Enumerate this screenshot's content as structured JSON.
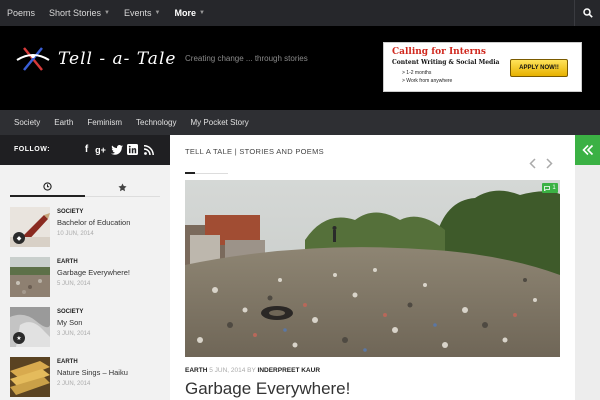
{
  "topnav": {
    "items": [
      {
        "label": "Poems"
      },
      {
        "label": "Short Stories"
      },
      {
        "label": "Events"
      },
      {
        "label": "More"
      }
    ]
  },
  "header": {
    "site_title": "Tell - a- Tale",
    "tagline": "Creating change ... through stories",
    "ad": {
      "title": "Calling for Interns",
      "subtitle": "Content Writing & Social Media",
      "bullet1": "> 1-2 months",
      "bullet2": "> Work from anywhere",
      "button": "APPLY NOW!!"
    }
  },
  "catnav": {
    "items": [
      {
        "label": "Society"
      },
      {
        "label": "Earth"
      },
      {
        "label": "Feminism"
      },
      {
        "label": "Technology"
      },
      {
        "label": "My Pocket Story"
      }
    ]
  },
  "sidebar": {
    "follow_label": "FOLLOW:",
    "posts": [
      {
        "category": "SOCIETY",
        "title": "Bachelor of Education",
        "date": "10 JUN, 2014",
        "icon": "camera-icon"
      },
      {
        "category": "EARTH",
        "title": "Garbage Everywhere!",
        "date": "5 JUN, 2014",
        "icon": ""
      },
      {
        "category": "SOCIETY",
        "title": "My Son",
        "date": "3 JUN, 2014",
        "icon": "star-icon"
      },
      {
        "category": "EARTH",
        "title": "Nature Sings – Haiku",
        "date": "2 JUN, 2014",
        "icon": ""
      }
    ]
  },
  "main": {
    "breadcrumb": "TELL A TALE | STORIES AND POEMS",
    "comment_count": "1",
    "meta": {
      "category": "EARTH",
      "date": "5 JUN, 2014",
      "by": "BY",
      "author": "INDERPREET KAUR"
    },
    "post_title": "Garbage Everywhere!"
  },
  "colors": {
    "accent": "#3bb144",
    "topbar": "#26272b",
    "header": "#000000",
    "catnav": "#2e2f33"
  }
}
